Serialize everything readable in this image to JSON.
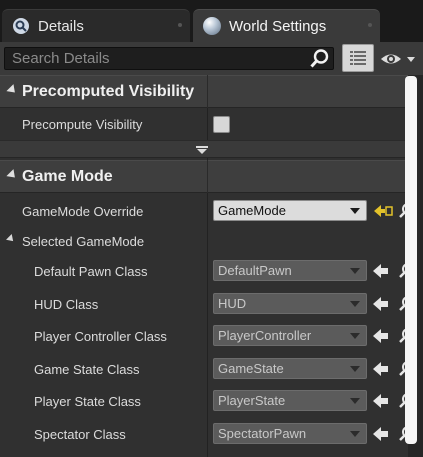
{
  "tabs": [
    {
      "label": "Details",
      "icon": "magnifier-icon",
      "active": false
    },
    {
      "label": "World Settings",
      "icon": "globe-icon",
      "active": true
    }
  ],
  "toolbar": {
    "search_placeholder": "Search Details",
    "search_icon": "search-icon",
    "view_options_icon": "list-grid-icon",
    "visibility_icon": "eye-icon"
  },
  "categories": {
    "precomputed": {
      "title": "Precomputed Visibility",
      "property_label": "Precompute Visibility",
      "checked": false
    },
    "gamemode": {
      "title": "Game Mode",
      "override_label": "GameMode Override",
      "override_value": "GameMode",
      "selected_label": "Selected GameMode",
      "properties": [
        {
          "label": "Default Pawn Class",
          "value": "DefaultPawn"
        },
        {
          "label": "HUD Class",
          "value": "HUD"
        },
        {
          "label": "Player Controller Class",
          "value": "PlayerController"
        },
        {
          "label": "Game State Class",
          "value": "GameState"
        },
        {
          "label": "Player State Class",
          "value": "PlayerState"
        },
        {
          "label": "Spectator Class",
          "value": "SpectatorPawn"
        }
      ]
    }
  },
  "colors": {
    "background": "#303030",
    "header": "#3e3e3e",
    "accent_yellow": "#e3c22a"
  }
}
